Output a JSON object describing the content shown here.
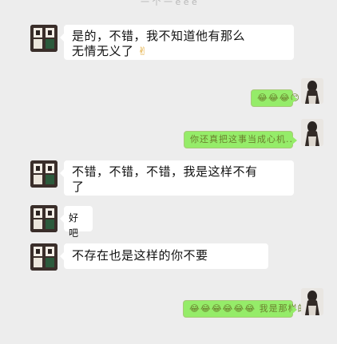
{
  "top_fragment": "一 个 一 e e e",
  "messages": [
    {
      "side": "left",
      "text": "是的，不错，我不知道他有那么",
      "text2": "无情无义了"
    },
    {
      "side": "right",
      "text": "😂😂😂😊"
    },
    {
      "side": "right",
      "text": "你还真把这事当成心机..."
    },
    {
      "side": "left",
      "text": "不错，不错，不错，我是这样不有",
      "text2": "了"
    },
    {
      "side": "left",
      "text": "好吧"
    },
    {
      "side": "left",
      "text": "不存在也是这样的你不要"
    },
    {
      "side": "right",
      "text": "😂😂😂😂😂😂 我是那样的人"
    }
  ],
  "colors": {
    "background": "#ededed",
    "bubble_left": "#ffffff",
    "bubble_right": "#95ec69"
  }
}
